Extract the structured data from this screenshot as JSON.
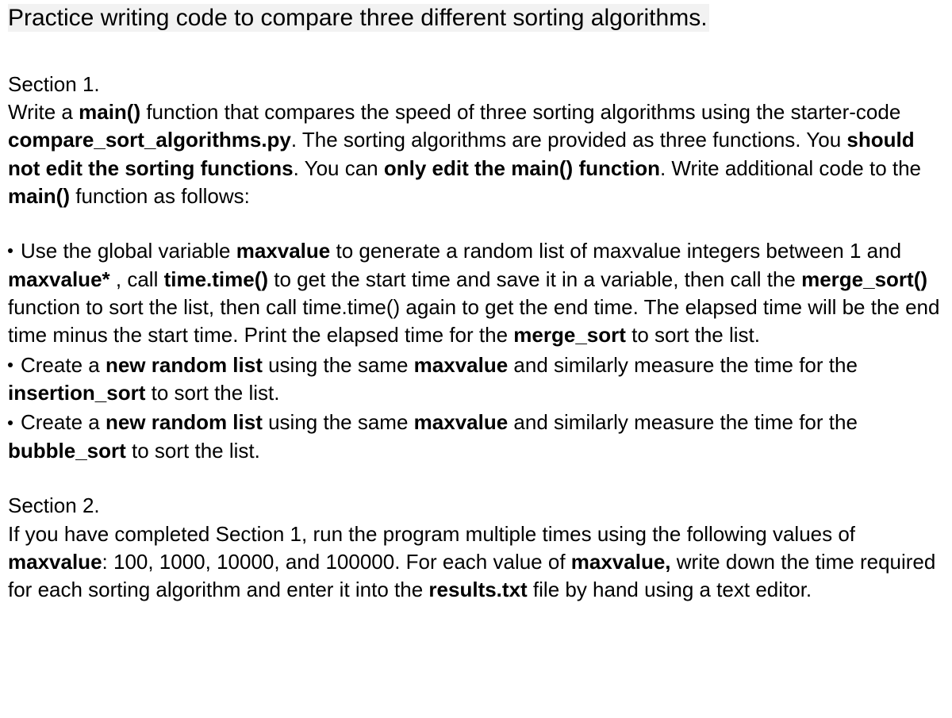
{
  "title": "Practice writing code to compare three different sorting algorithms.",
  "section1": {
    "label": "Section 1.",
    "intro": {
      "t1": "Write a ",
      "b1": "main()",
      "t2": " function that compares the speed of three sorting algorithms using the starter-code ",
      "b2": "compare_sort_algorithms.py",
      "t3": ". The sorting algorithms are provided as three functions. You ",
      "b3": "should not edit the sorting functions",
      "t4": ". You can ",
      "b4": "only edit the main() function",
      "t5": ". Write additional code to the ",
      "b5": "main()",
      "t6": " function as follows:"
    },
    "bullets": {
      "b1": {
        "t1": "Use the global variable ",
        "s1": "maxvalue",
        "t2": " to generate a random list of maxvalue integers between 1 and ",
        "s2": "maxvalue*",
        "t3": " , call ",
        "s3": "time.time()",
        "t4": " to get the start time and save it in a variable, then call the ",
        "s4": "merge_sort()",
        "t5": " function to sort the list, then call time.time() again to get the end time. The elapsed time will be the end time minus the start time. Print the elapsed time for the ",
        "s5": "merge_sort",
        "t6": " to sort the list."
      },
      "b2": {
        "t1": "Create a ",
        "s1": "new random list",
        "t2": " using the same ",
        "s2": "maxvalue",
        "t3": " and similarly measure the time for the ",
        "s3": "insertion_sort",
        "t4": " to sort the list."
      },
      "b3": {
        "t1": "Create a ",
        "s1": "new random list",
        "t2": " using the same ",
        "s2": "maxvalue",
        "t3": " and similarly measure the time for the ",
        "s3": "bubble_sort",
        "t4": " to sort the list."
      }
    }
  },
  "section2": {
    "label": "Section 2.",
    "body": {
      "t1": "If you have completed Section 1, run the program multiple times using the following values of ",
      "s1": "maxvalue",
      "t2": ": 100, 1000, 10000, and 100000. For each value of ",
      "s2": "maxvalue,",
      "t3": " write down the time required for each sorting algorithm and enter it into the ",
      "s3": "results.txt",
      "t4": " file by hand using a text editor."
    }
  }
}
